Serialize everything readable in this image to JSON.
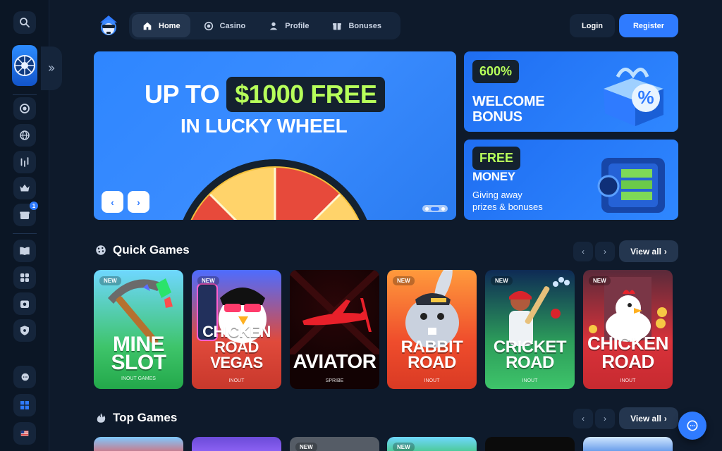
{
  "nav": {
    "items": [
      {
        "label": "Home",
        "icon": "home-icon",
        "active": true
      },
      {
        "label": "Casino",
        "icon": "chip-icon",
        "active": false
      },
      {
        "label": "Profile",
        "icon": "user-icon",
        "active": false
      },
      {
        "label": "Bonuses",
        "icon": "gift-icon",
        "active": false
      }
    ],
    "login": "Login",
    "register": "Register"
  },
  "hero": {
    "prefix": "UP TO",
    "amount": "$1000 FREE",
    "line2": "IN LUCKY WHEEL"
  },
  "promos": [
    {
      "tag": "600%",
      "title_line1": "WELCOME",
      "title_line2": "BONUS"
    },
    {
      "tag": "FREE",
      "title": "MONEY",
      "sub_line1": "Giving away",
      "sub_line2": "prizes & bonuses"
    }
  ],
  "quick_games": {
    "title": "Quick Games",
    "view_all": "View all",
    "games": [
      {
        "line1": "MINE",
        "line2": "SLOT",
        "provider": "INOUT GAMES",
        "is_new": true,
        "badge": "NEW"
      },
      {
        "line1": "CHICKEN",
        "line2": "ROAD VEGAS",
        "provider": "INOUT",
        "is_new": true,
        "badge": "NEW"
      },
      {
        "line1": "AVIATOR",
        "line2": "",
        "provider": "SPRIBE",
        "is_new": false,
        "badge": ""
      },
      {
        "line1": "RABBIT",
        "line2": "ROAD",
        "provider": "INOUT",
        "is_new": true,
        "badge": "NEW"
      },
      {
        "line1": "CRICKET",
        "line2": "ROAD",
        "provider": "INOUT",
        "is_new": true,
        "badge": "NEW"
      },
      {
        "line1": "CHICKEN",
        "line2": "ROAD",
        "provider": "INOUT",
        "is_new": true,
        "badge": "NEW"
      }
    ]
  },
  "top_games": {
    "title": "Top Games",
    "view_all": "View all",
    "badges": [
      "",
      "",
      "NEW",
      "NEW",
      "",
      ""
    ]
  },
  "colors": {
    "accent": "#2f7bff",
    "lime": "#b6ff5a",
    "bg": "#0e1a2b"
  }
}
